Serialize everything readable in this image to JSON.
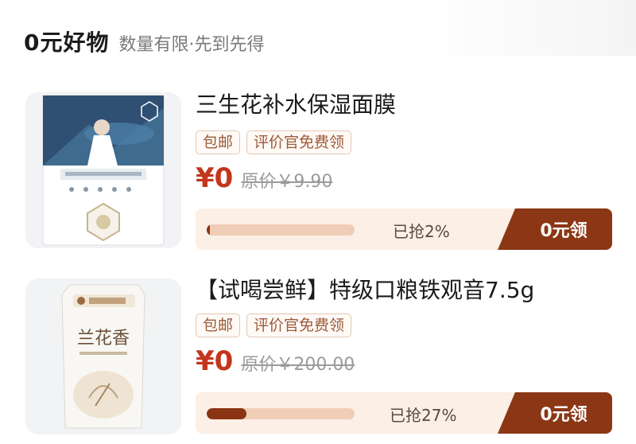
{
  "header": {
    "title": "0元好物",
    "subtitle": "数量有限·先到先得"
  },
  "products": [
    {
      "title": "三生花补水保湿面膜",
      "tags": [
        "包邮",
        "评价官免费领"
      ],
      "price": "¥0",
      "original_price": "原价￥9.90",
      "grabbed_text": "已抢2%",
      "progress_percent": 2,
      "claim_label": "0元领",
      "image_icon": "face-mask-package-image"
    },
    {
      "title": "【试喝尝鲜】特级口粮铁观音7.5g",
      "tags": [
        "包邮",
        "评价官免费领"
      ],
      "price": "¥0",
      "original_price": "原价￥200.00",
      "grabbed_text": "已抢27%",
      "progress_percent": 27,
      "claim_label": "0元领",
      "image_icon": "tea-package-image",
      "package_text": "兰花香"
    }
  ],
  "colors": {
    "accent": "#8b3614",
    "price": "#c3361d",
    "tag_text": "#9c5a3a",
    "bar_bg": "#fbefe6"
  }
}
